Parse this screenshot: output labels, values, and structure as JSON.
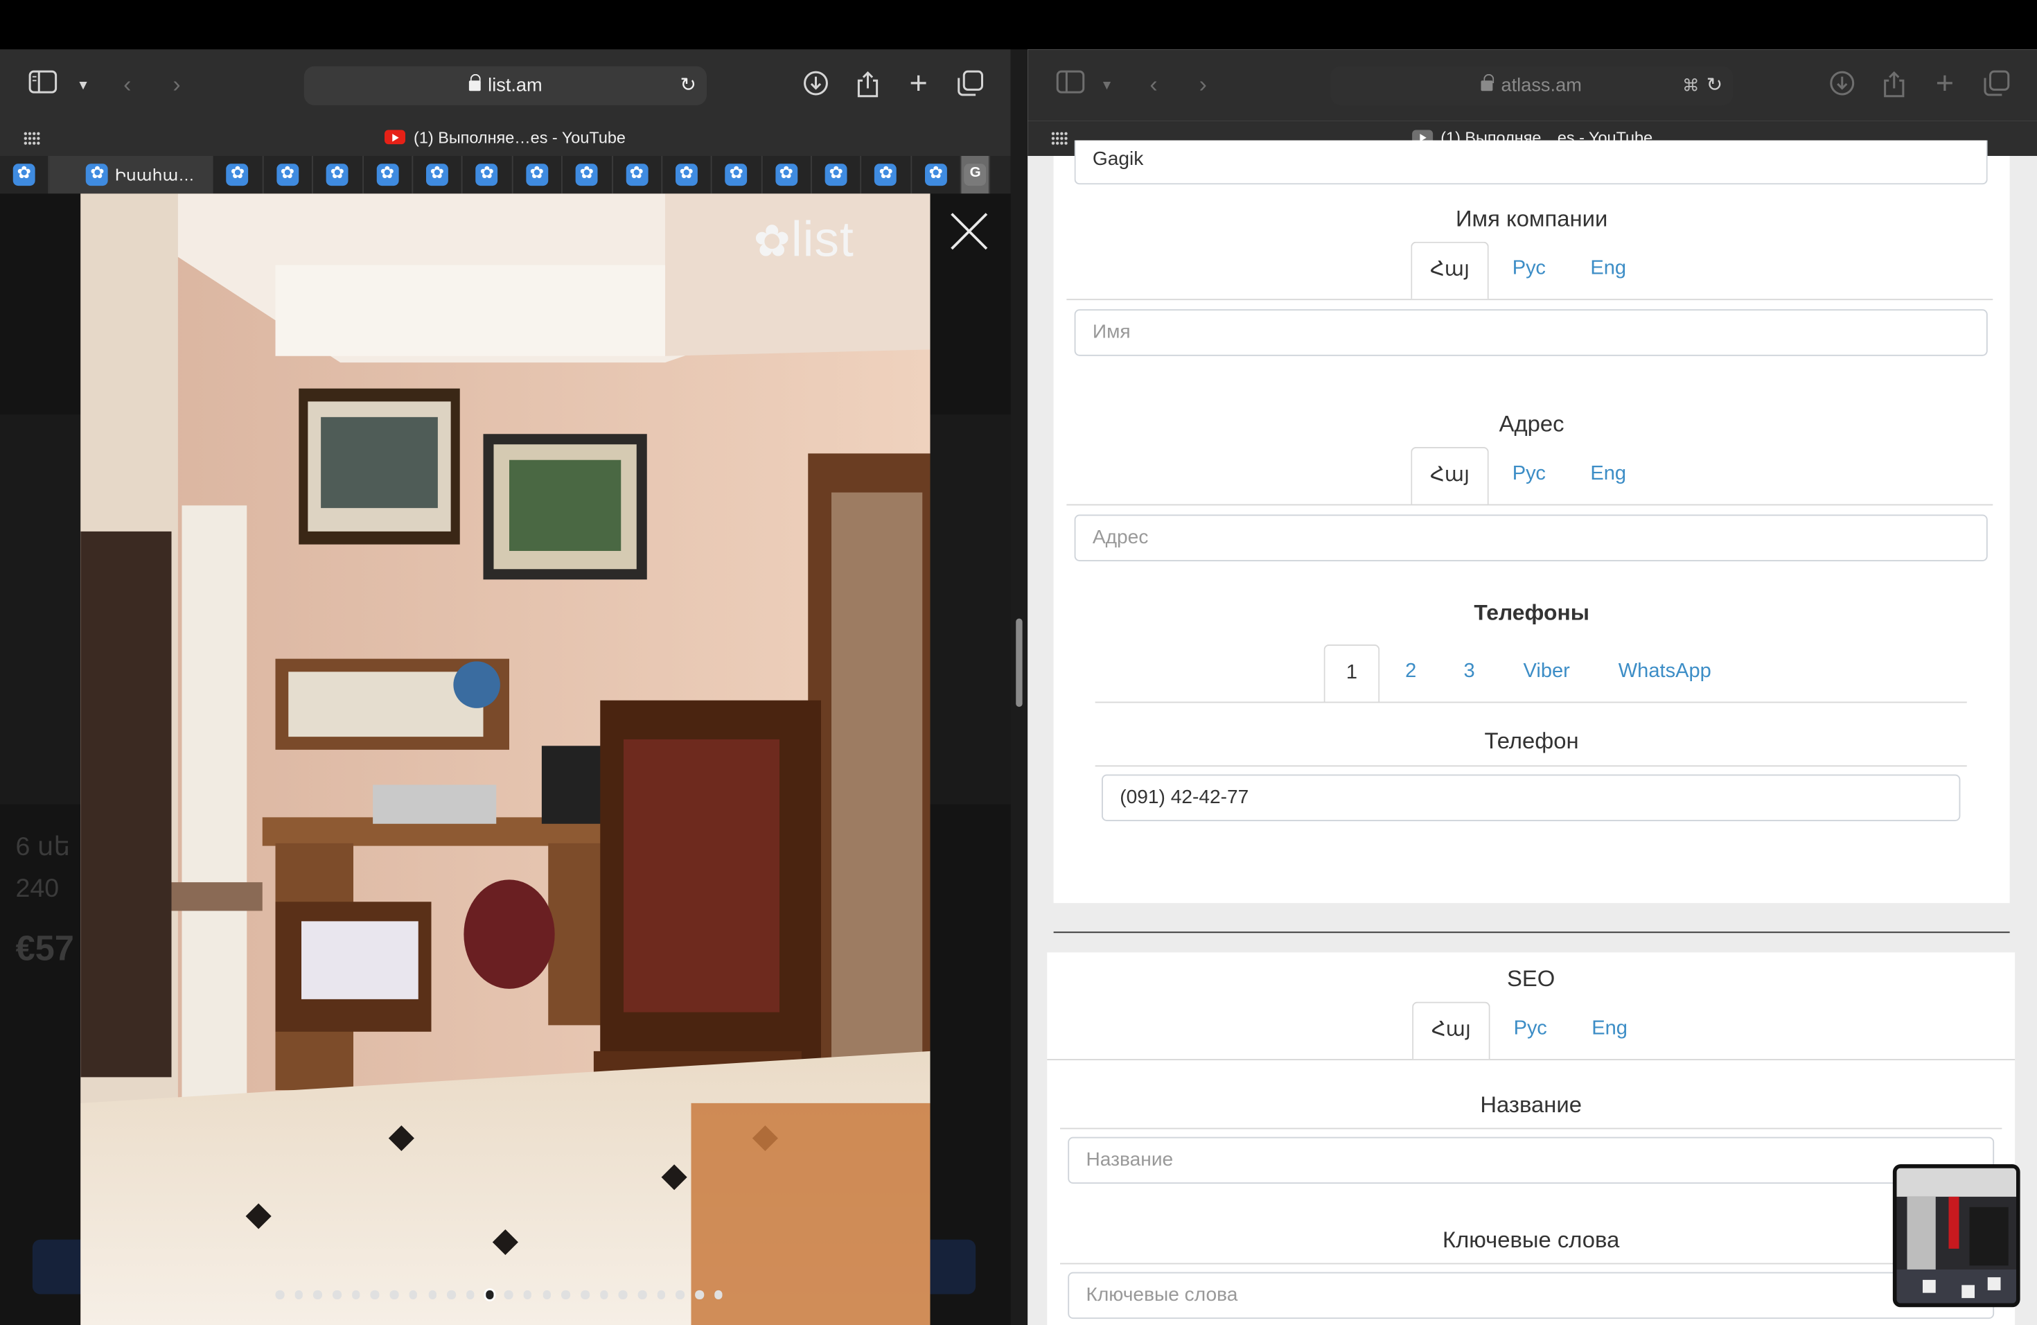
{
  "left": {
    "url": "list.am",
    "tab_title": "(1) Выполняе…es - YouTube",
    "bookmarks": {
      "active_label": "Իսահա…",
      "last_letter": "G"
    },
    "photo": {
      "brand": "list",
      "dot_count": 24,
      "active_dot": 11
    },
    "behind": {
      "price_fragment": "€57",
      "line1": "6 սե",
      "line2": "240"
    }
  },
  "right": {
    "url": "atlass.am",
    "tab_title": "(1) Выполняе…es - YouTube",
    "name_value": "Gagik",
    "company": {
      "label": "Имя компании",
      "tabs": [
        "Հայ",
        "Рус",
        "Eng"
      ],
      "placeholder": "Имя"
    },
    "address": {
      "label": "Адрес",
      "tabs": [
        "Հայ",
        "Рус",
        "Eng"
      ],
      "placeholder": "Адрес"
    },
    "phones": {
      "label": "Телефоны",
      "tabs": [
        "1",
        "2",
        "3",
        "Viber",
        "WhatsApp"
      ],
      "field_label": "Телефон",
      "value": "(091) 42-42-77"
    },
    "seo": {
      "label": "SEO",
      "tabs": [
        "Հայ",
        "Рус",
        "Eng"
      ],
      "title_label": "Название",
      "title_placeholder": "Название",
      "keywords_label": "Ключевые слова",
      "keywords_placeholder": "Ключевые слова"
    }
  },
  "icons": [
    "sidebar-icon",
    "chevron-down-icon",
    "back-icon",
    "forward-icon",
    "lock-icon",
    "reload-icon",
    "download-icon",
    "share-icon",
    "new-tab-icon",
    "tabs-overview-icon",
    "translate-icon",
    "close-icon",
    "grid-icon"
  ]
}
